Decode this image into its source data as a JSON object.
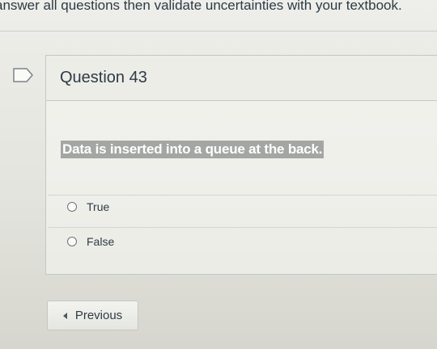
{
  "page": {
    "instruction": "answer all questions then validate uncertainties with your textbook."
  },
  "question": {
    "title": "Question 43",
    "text": "Data is inserted into a queue at the back.",
    "flag_icon": "flag-icon",
    "answers": [
      {
        "label": "True"
      },
      {
        "label": "False"
      }
    ]
  },
  "navigation": {
    "previous_label": "Previous",
    "previous_icon": "caret-left-icon"
  },
  "colors": {
    "text": "#2d3b45",
    "highlight": "#a4a6a3",
    "border": "#c4c7c2"
  }
}
